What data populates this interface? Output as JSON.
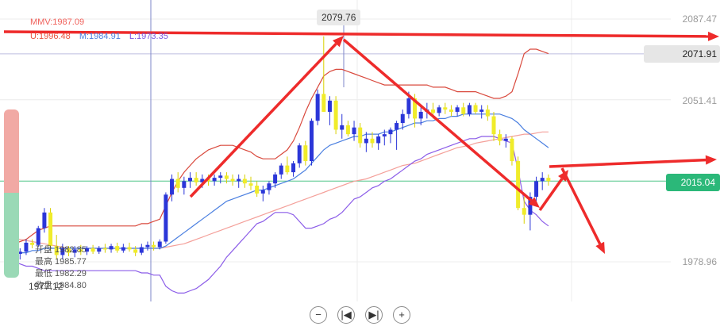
{
  "indicators": {
    "mmv": "MMV:1987.09",
    "upper": "U:1996.48",
    "middle": "M:1984.91",
    "lower": "L:1973.35",
    "colors": {
      "mmv": "#f0605a",
      "upper": "#e9533f",
      "middle": "#4a7fe0",
      "lower": "#7a55e0"
    }
  },
  "ohlc_tooltip": {
    "open": "开盘 1982.85",
    "high": "最高 1985.77",
    "low": "最低 1982.29",
    "close": "收盘 1984.80",
    "low_marker": "1977.12"
  },
  "price_tags": {
    "period_high": "2079.76",
    "alert": "2071.91",
    "last": "2015.04"
  },
  "controls": {
    "zoom_out": "−",
    "prev": "|◀",
    "next": "▶|",
    "zoom_in": "+"
  },
  "slider": {
    "top_color": "#f1a9a4",
    "bottom_color": "#9ad9b6"
  },
  "chart_data": {
    "type": "candlestick",
    "y_ticks": [
      1978.96,
      2015.04,
      2051.41,
      2087.47
    ],
    "ylim": [
      1962,
      2093
    ],
    "candles": [
      [
        1982.5,
        1986,
        1980,
        1984.5
      ],
      [
        1984.5,
        1986,
        1981,
        1982.5
      ],
      [
        1982.5,
        1985,
        1980,
        1983.5
      ],
      [
        1983.5,
        1989,
        1982,
        1987.5
      ],
      [
        1987.5,
        1989,
        1985,
        1986.5
      ],
      [
        1986.5,
        1995,
        1985.5,
        1994
      ],
      [
        1994,
        2003,
        1992,
        2001
      ],
      [
        2001,
        2003,
        1984,
        1986
      ],
      [
        1986,
        1991,
        1980,
        1982
      ],
      [
        1982,
        1987,
        1980,
        1985
      ],
      [
        1985,
        1986,
        1981.5,
        1983
      ],
      [
        1983,
        1986,
        1981,
        1984.5
      ],
      [
        1984.5,
        1986.5,
        1982,
        1983.5
      ],
      [
        1983.5,
        1986,
        1982,
        1985
      ],
      [
        1985,
        1986.5,
        1982.5,
        1983.5
      ],
      [
        1983.5,
        1986,
        1982.5,
        1985
      ],
      [
        1985,
        1987,
        1983,
        1984.5
      ],
      [
        1984.5,
        1987,
        1983,
        1986
      ],
      [
        1986,
        1987.5,
        1983,
        1984
      ],
      [
        1984,
        1987,
        1983,
        1985.5
      ],
      [
        1985.5,
        1987.5,
        1983.5,
        1984.5
      ],
      [
        1984.5,
        1986,
        1981.5,
        1983
      ],
      [
        1983,
        1987,
        1982,
        1985.5
      ],
      [
        1985.5,
        1988,
        1984,
        1986.5
      ],
      [
        1986.5,
        1988,
        1984,
        1985.5
      ],
      [
        1985.5,
        1989,
        1984.5,
        1988
      ],
      [
        1988,
        2010,
        1987,
        2009
      ],
      [
        2009,
        2018,
        2006,
        2016
      ],
      [
        2016,
        2019,
        2010,
        2012
      ],
      [
        2012,
        2017,
        2009,
        2015
      ],
      [
        2015,
        2019,
        2012,
        2016.5
      ],
      [
        2016.5,
        2019,
        2013,
        2014.5
      ],
      [
        2014.5,
        2018,
        2012,
        2016
      ],
      [
        2016,
        2018,
        2013,
        2015
      ],
      [
        2015,
        2018,
        2013,
        2016.5
      ],
      [
        2016.5,
        2019,
        2014,
        2017.5
      ],
      [
        2017.5,
        2019,
        2014,
        2016
      ],
      [
        2016,
        2018,
        2013,
        2015
      ],
      [
        2015,
        2018,
        2012,
        2016
      ],
      [
        2016,
        2018,
        2012,
        2014
      ],
      [
        2014,
        2017,
        2011,
        2013
      ],
      [
        2013,
        2015,
        2008,
        2009.5
      ],
      [
        2009.5,
        2013,
        2006,
        2011
      ],
      [
        2011,
        2015,
        2009,
        2014
      ],
      [
        2014,
        2019,
        2012,
        2018
      ],
      [
        2018,
        2023,
        2016,
        2022
      ],
      [
        2022,
        2026,
        2018,
        2019
      ],
      [
        2019,
        2024,
        2017,
        2023
      ],
      [
        2023,
        2032,
        2021,
        2031
      ],
      [
        2031,
        2033,
        2022,
        2024
      ],
      [
        2024,
        2043,
        2022,
        2042
      ],
      [
        2042,
        2056,
        2040,
        2054
      ],
      [
        2054,
        2079.76,
        2046,
        2046
      ],
      [
        2046,
        2053,
        2040,
        2051
      ],
      [
        2051,
        2053,
        2036,
        2038
      ],
      [
        2038,
        2045,
        2034,
        2040
      ],
      [
        2040,
        2042,
        2035,
        2036
      ],
      [
        2036,
        2042,
        2033,
        2039
      ],
      [
        2039,
        2041,
        2030,
        2032
      ],
      [
        2032,
        2037,
        2028,
        2034
      ],
      [
        2034,
        2037,
        2030,
        2032
      ],
      [
        2032,
        2036,
        2029,
        2035
      ],
      [
        2035,
        2038,
        2031,
        2036
      ],
      [
        2036,
        2039,
        2032,
        2038
      ],
      [
        2038,
        2042,
        2029,
        2041
      ],
      [
        2041,
        2047,
        2038,
        2045
      ],
      [
        2045,
        2055,
        2043,
        2052
      ],
      [
        2052,
        2054,
        2039,
        2043
      ],
      [
        2043,
        2048,
        2040,
        2046
      ],
      [
        2046,
        2050,
        2043,
        2047
      ],
      [
        2047,
        2050,
        2043,
        2045.5
      ],
      [
        2045.5,
        2049,
        2044,
        2048
      ],
      [
        2048,
        2050,
        2045,
        2047
      ],
      [
        2047,
        2049,
        2044,
        2046
      ],
      [
        2046,
        2049,
        2044,
        2048
      ],
      [
        2048,
        2050,
        2044,
        2045
      ],
      [
        2045,
        2050,
        2044,
        2049
      ],
      [
        2049,
        2050,
        2045,
        2046
      ],
      [
        2046,
        2049,
        2043,
        2047
      ],
      [
        2047,
        2049,
        2042,
        2044
      ],
      [
        2044,
        2046,
        2033,
        2036
      ],
      [
        2036,
        2038,
        2031,
        2033
      ],
      [
        2033,
        2036,
        2030,
        2034
      ],
      [
        2034,
        2035,
        2022,
        2024
      ],
      [
        2024,
        2026,
        2002,
        2003
      ],
      [
        2003,
        2008,
        1996,
        2000
      ],
      [
        2000,
        2010,
        1993,
        2008
      ],
      [
        2008,
        2017,
        2005,
        2015
      ],
      [
        2015,
        2019,
        2011,
        2016.5
      ],
      [
        2016.5,
        2018,
        2013,
        2015.04
      ]
    ],
    "bands": {
      "upper": [
        1986,
        1987,
        1988,
        1989,
        1991,
        1993,
        1994,
        1995,
        1995,
        1995,
        1995,
        1995,
        1995,
        1995,
        1995,
        1995,
        1995,
        1995,
        1995,
        1995,
        1995,
        1995,
        1996,
        1996,
        1997,
        1998,
        2004,
        2010,
        2015,
        2019,
        2022,
        2025,
        2027,
        2029,
        2030,
        2031,
        2031,
        2031,
        2030,
        2029,
        2028,
        2026,
        2025,
        2025,
        2025,
        2027,
        2029,
        2033,
        2039,
        2046,
        2052,
        2057,
        2062,
        2064,
        2065,
        2065,
        2064,
        2063,
        2062,
        2061,
        2060,
        2059,
        2058,
        2058,
        2058,
        2058,
        2058,
        2058,
        2058,
        2058,
        2057,
        2057,
        2057,
        2056,
        2055,
        2055,
        2055,
        2055,
        2054,
        2053,
        2052,
        2052,
        2053,
        2055,
        2063,
        2072,
        2074,
        2074,
        2073,
        2072
      ],
      "middle": [
        1983,
        1983,
        1983,
        1983,
        1984,
        1984,
        1985,
        1985,
        1985,
        1985,
        1985,
        1985,
        1985,
        1985,
        1985,
        1985,
        1985,
        1985,
        1985,
        1985,
        1985,
        1985,
        1985,
        1985,
        1985,
        1985,
        1986,
        1988,
        1990,
        1992,
        1994,
        1996,
        1998,
        2000,
        2002,
        2004,
        2006,
        2007,
        2008,
        2009,
        2010,
        2011,
        2011,
        2012,
        2013,
        2014,
        2015,
        2016,
        2018,
        2020,
        2023,
        2026,
        2029,
        2031,
        2032,
        2033,
        2034,
        2035,
        2035,
        2036,
        2036,
        2036,
        2037,
        2037,
        2038,
        2039,
        2040,
        2041,
        2041,
        2042,
        2042,
        2043,
        2043,
        2044,
        2044,
        2045,
        2045,
        2045,
        2045,
        2045,
        2045,
        2045,
        2044,
        2043,
        2041,
        2038,
        2036,
        2034,
        2032,
        2030
      ],
      "lower": [
        1980,
        1979,
        1978,
        1977,
        1977,
        1976,
        1975,
        1975,
        1975,
        1975,
        1975,
        1975,
        1975,
        1975,
        1975,
        1975,
        1975,
        1975,
        1975,
        1975,
        1975,
        1975,
        1974,
        1974,
        1973,
        1973,
        1968,
        1966,
        1965,
        1965,
        1966,
        1967,
        1969,
        1971,
        1974,
        1977,
        1981,
        1984,
        1987,
        1990,
        1993,
        1996,
        1997,
        1999,
        2001,
        2001,
        2001,
        2000,
        1997,
        1994,
        1994,
        1995,
        1996,
        1998,
        1999,
        2001,
        2004,
        2007,
        2008,
        2010,
        2012,
        2013,
        2015,
        2016,
        2018,
        2020,
        2022,
        2024,
        2025,
        2027,
        2028,
        2029,
        2030,
        2031,
        2032,
        2033,
        2034,
        2034,
        2035,
        2035,
        2035,
        2034,
        2033,
        2032,
        2020,
        2006,
        2002,
        2000,
        1997,
        1995
      ],
      "mmv": [
        1990,
        1989.5,
        1989,
        1988.5,
        1988,
        1987.5,
        1987,
        1986.5,
        1986,
        1985.5,
        1985,
        1985,
        1985,
        1985,
        1985,
        1985,
        1985,
        1985,
        1985,
        1985,
        1985,
        1985,
        1985,
        1985,
        1985,
        1985,
        1985.5,
        1986,
        1986.5,
        1987,
        1988,
        1989,
        1990,
        1991,
        1992,
        1993,
        1994,
        1995,
        1996,
        1997,
        1998,
        1999,
        2000,
        2001,
        2002,
        2003,
        2004,
        2005,
        2006,
        2007,
        2008,
        2009,
        2010,
        2011,
        2012,
        2013,
        2014,
        2015,
        2015.5,
        2016,
        2017,
        2018,
        2019,
        2020,
        2021,
        2022,
        2022.5,
        2023,
        2024,
        2025,
        2026,
        2027,
        2028,
        2029,
        2030,
        2030.5,
        2031,
        2032,
        2032.5,
        2033,
        2033.5,
        2034,
        2034.5,
        2035,
        2035.5,
        2036,
        2036,
        2036.5,
        2037,
        2037
      ]
    },
    "colors": {
      "up": "#2b36d8",
      "down": "#f0ec2a",
      "wick_up": "#2b36d8",
      "wick_down": "#d8d000",
      "arrows": "#ee2b2b",
      "alert_line": "#ec3b3b"
    }
  }
}
